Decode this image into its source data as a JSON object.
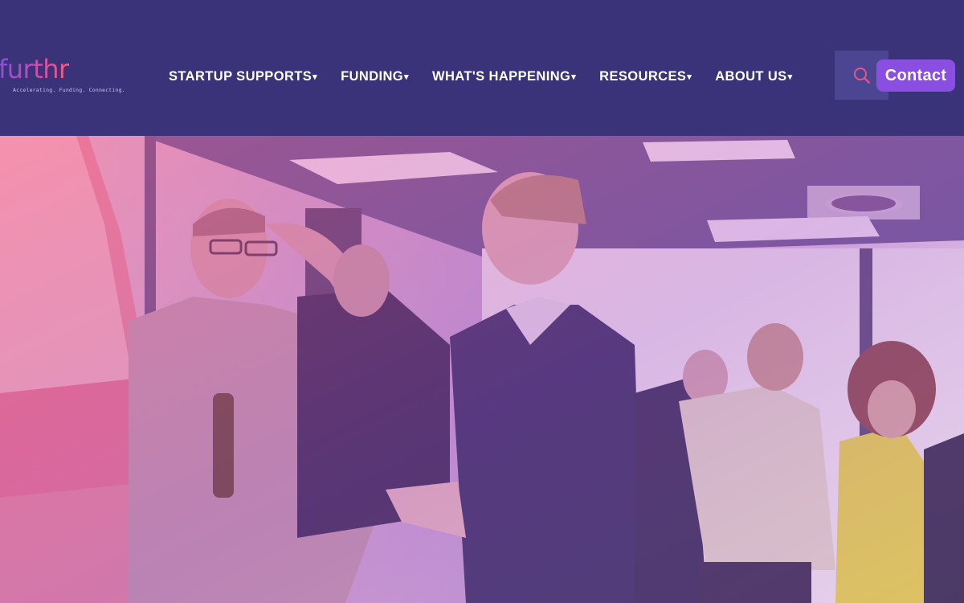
{
  "brand": {
    "name": "furthr",
    "tagline": "Accelerating. Funding. Connecting.",
    "gradient_start": "#8a4ed8",
    "gradient_end": "#ff5a7a"
  },
  "header": {
    "background": "#3a3379",
    "nav": [
      {
        "label": "STARTUP SUPPORTS",
        "caret": "▾"
      },
      {
        "label": "FUNDING",
        "caret": "▾"
      },
      {
        "label": "WHAT'S HAPPENING",
        "caret": "▾"
      },
      {
        "label": "RESOURCES",
        "caret": "▾"
      },
      {
        "label": "ABOUT US",
        "caret": "▾"
      }
    ],
    "search_icon": "search-icon",
    "contact_label": "Contact",
    "accent": "#8a4ee0"
  },
  "hero": {
    "image": "networking-event-photo",
    "overlay_color": "#b04fd0"
  }
}
